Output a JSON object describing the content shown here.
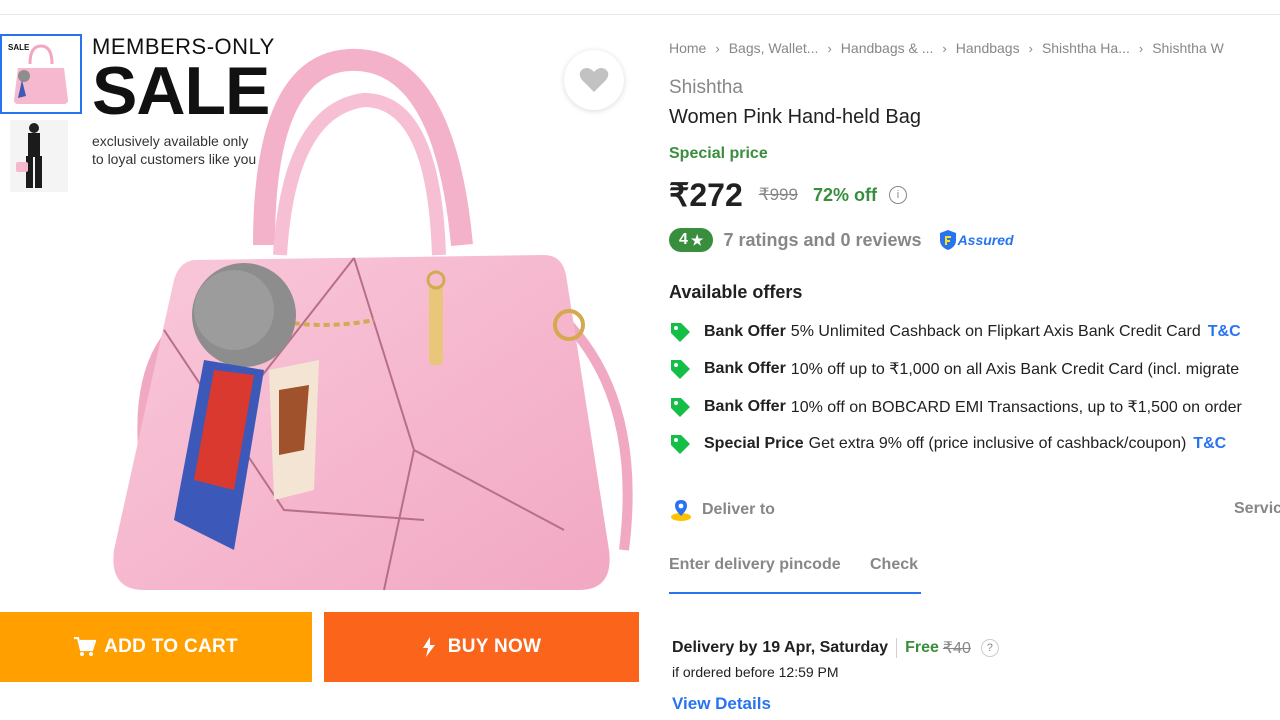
{
  "gallery": {
    "thumb1_badge": "SALE",
    "promo_line1": "MEMBERS-ONLY",
    "promo_line2": "SALE",
    "promo_line3": "exclusively available only",
    "promo_line4": "to loyal customers like you"
  },
  "actions": {
    "add_to_cart": "ADD TO CART",
    "buy_now": "BUY NOW"
  },
  "breadcrumb": [
    "Home",
    "Bags, Wallet...",
    "Handbags & ...",
    "Handbags",
    "Shishtha Ha...",
    "Shishtha W"
  ],
  "product": {
    "brand": "Shishtha",
    "title": "Women Pink Hand-held Bag",
    "special_label": "Special price",
    "price": "₹272",
    "mrp": "₹999",
    "discount": "72% off",
    "info": "i",
    "rating": "4",
    "rating_star": "★",
    "ratings_text": "7 ratings and 0 reviews",
    "assured": "Assured"
  },
  "offers": {
    "heading": "Available offers",
    "items": [
      {
        "type": "Bank Offer",
        "text": "5% Unlimited Cashback on Flipkart Axis Bank Credit Card",
        "link": "T&C"
      },
      {
        "type": "Bank Offer",
        "text": "10% off up to ₹1,000 on all Axis Bank Credit Card (incl. migrate",
        "link": ""
      },
      {
        "type": "Bank Offer",
        "text": "10% off on BOBCARD EMI Transactions, up to ₹1,500 on order",
        "link": ""
      },
      {
        "type": "Special Price",
        "text": "Get extra 9% off (price inclusive of cashback/coupon)",
        "link": "T&C"
      }
    ]
  },
  "delivery": {
    "deliver_to": "Deliver to",
    "services": "Servic",
    "pincode_placeholder": "Enter delivery pincode",
    "check": "Check",
    "delivery_by_label": "Delivery by",
    "delivery_date": "19 Apr, Saturday",
    "free": "Free",
    "old_charge": "₹40",
    "help": "?",
    "ordered_before": "if ordered before 12:59 PM",
    "view_details": "View Details"
  },
  "colors": {
    "accent": "#2874f0",
    "green": "#388e3c",
    "cart": "#ff9f00",
    "buy": "#fb641b"
  }
}
